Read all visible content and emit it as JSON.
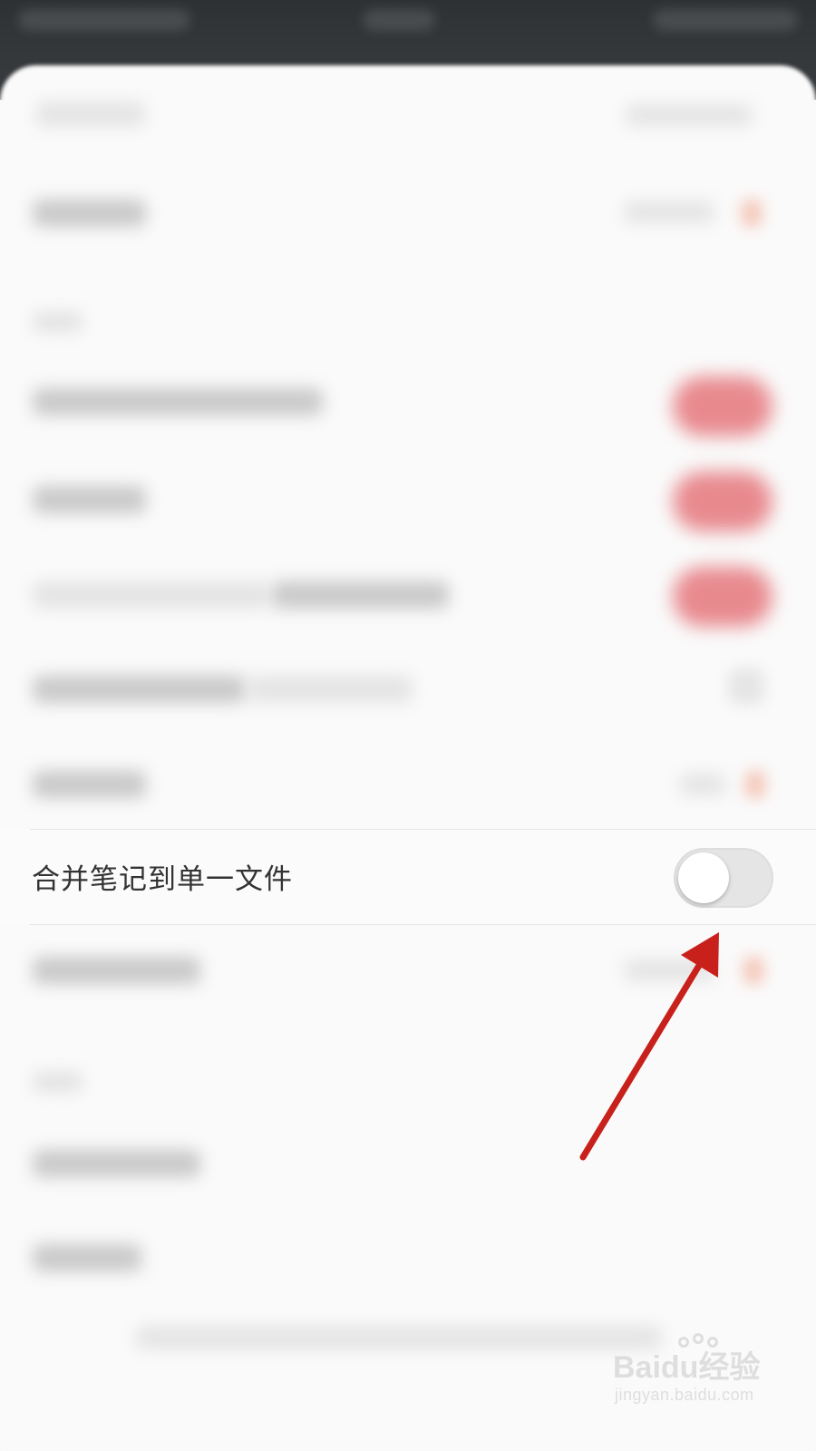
{
  "setting_row": {
    "label": "合并笔记到单一文件",
    "toggle_state": "off"
  },
  "colors": {
    "annotation_arrow": "#c8201a",
    "toggle_off": "#e5e5e5",
    "toggle_on_blurred": "#e46e74"
  },
  "icons": {
    "toggle": "toggle-switch-icon",
    "arrow": "red-arrow-annotation-icon"
  },
  "watermark": {
    "brand": "Baidu经验",
    "url": "jingyan.baidu.com"
  }
}
